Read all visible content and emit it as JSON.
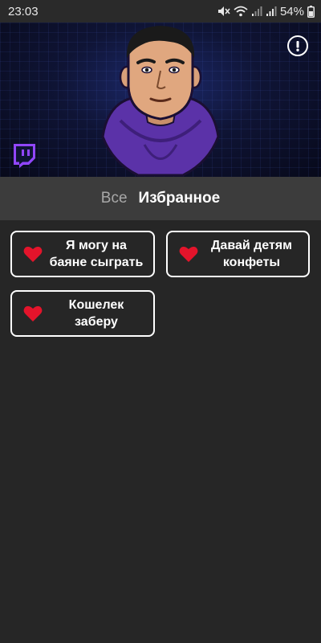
{
  "status_bar": {
    "time": "23:03",
    "battery": "54%",
    "icons": [
      "mute-icon",
      "wifi-icon",
      "signal-icon",
      "signal-icon",
      "battery-icon"
    ]
  },
  "banner": {
    "icons": [
      "info-icon",
      "twitch-icon"
    ],
    "accent_color": "#9146ff"
  },
  "tabs": [
    {
      "label": "Все",
      "active": false
    },
    {
      "label": "Избранное",
      "active": true
    }
  ],
  "sounds": [
    {
      "label": "Я могу на\nбаяне сыграть",
      "favorite": true
    },
    {
      "label": "Давай детям\nконфеты",
      "favorite": true
    },
    {
      "label": "Кошелек\nзаберу",
      "favorite": true
    }
  ],
  "colors": {
    "background": "#262626",
    "tab_bar": "#3c3c3c",
    "heart": "#e3142b"
  }
}
